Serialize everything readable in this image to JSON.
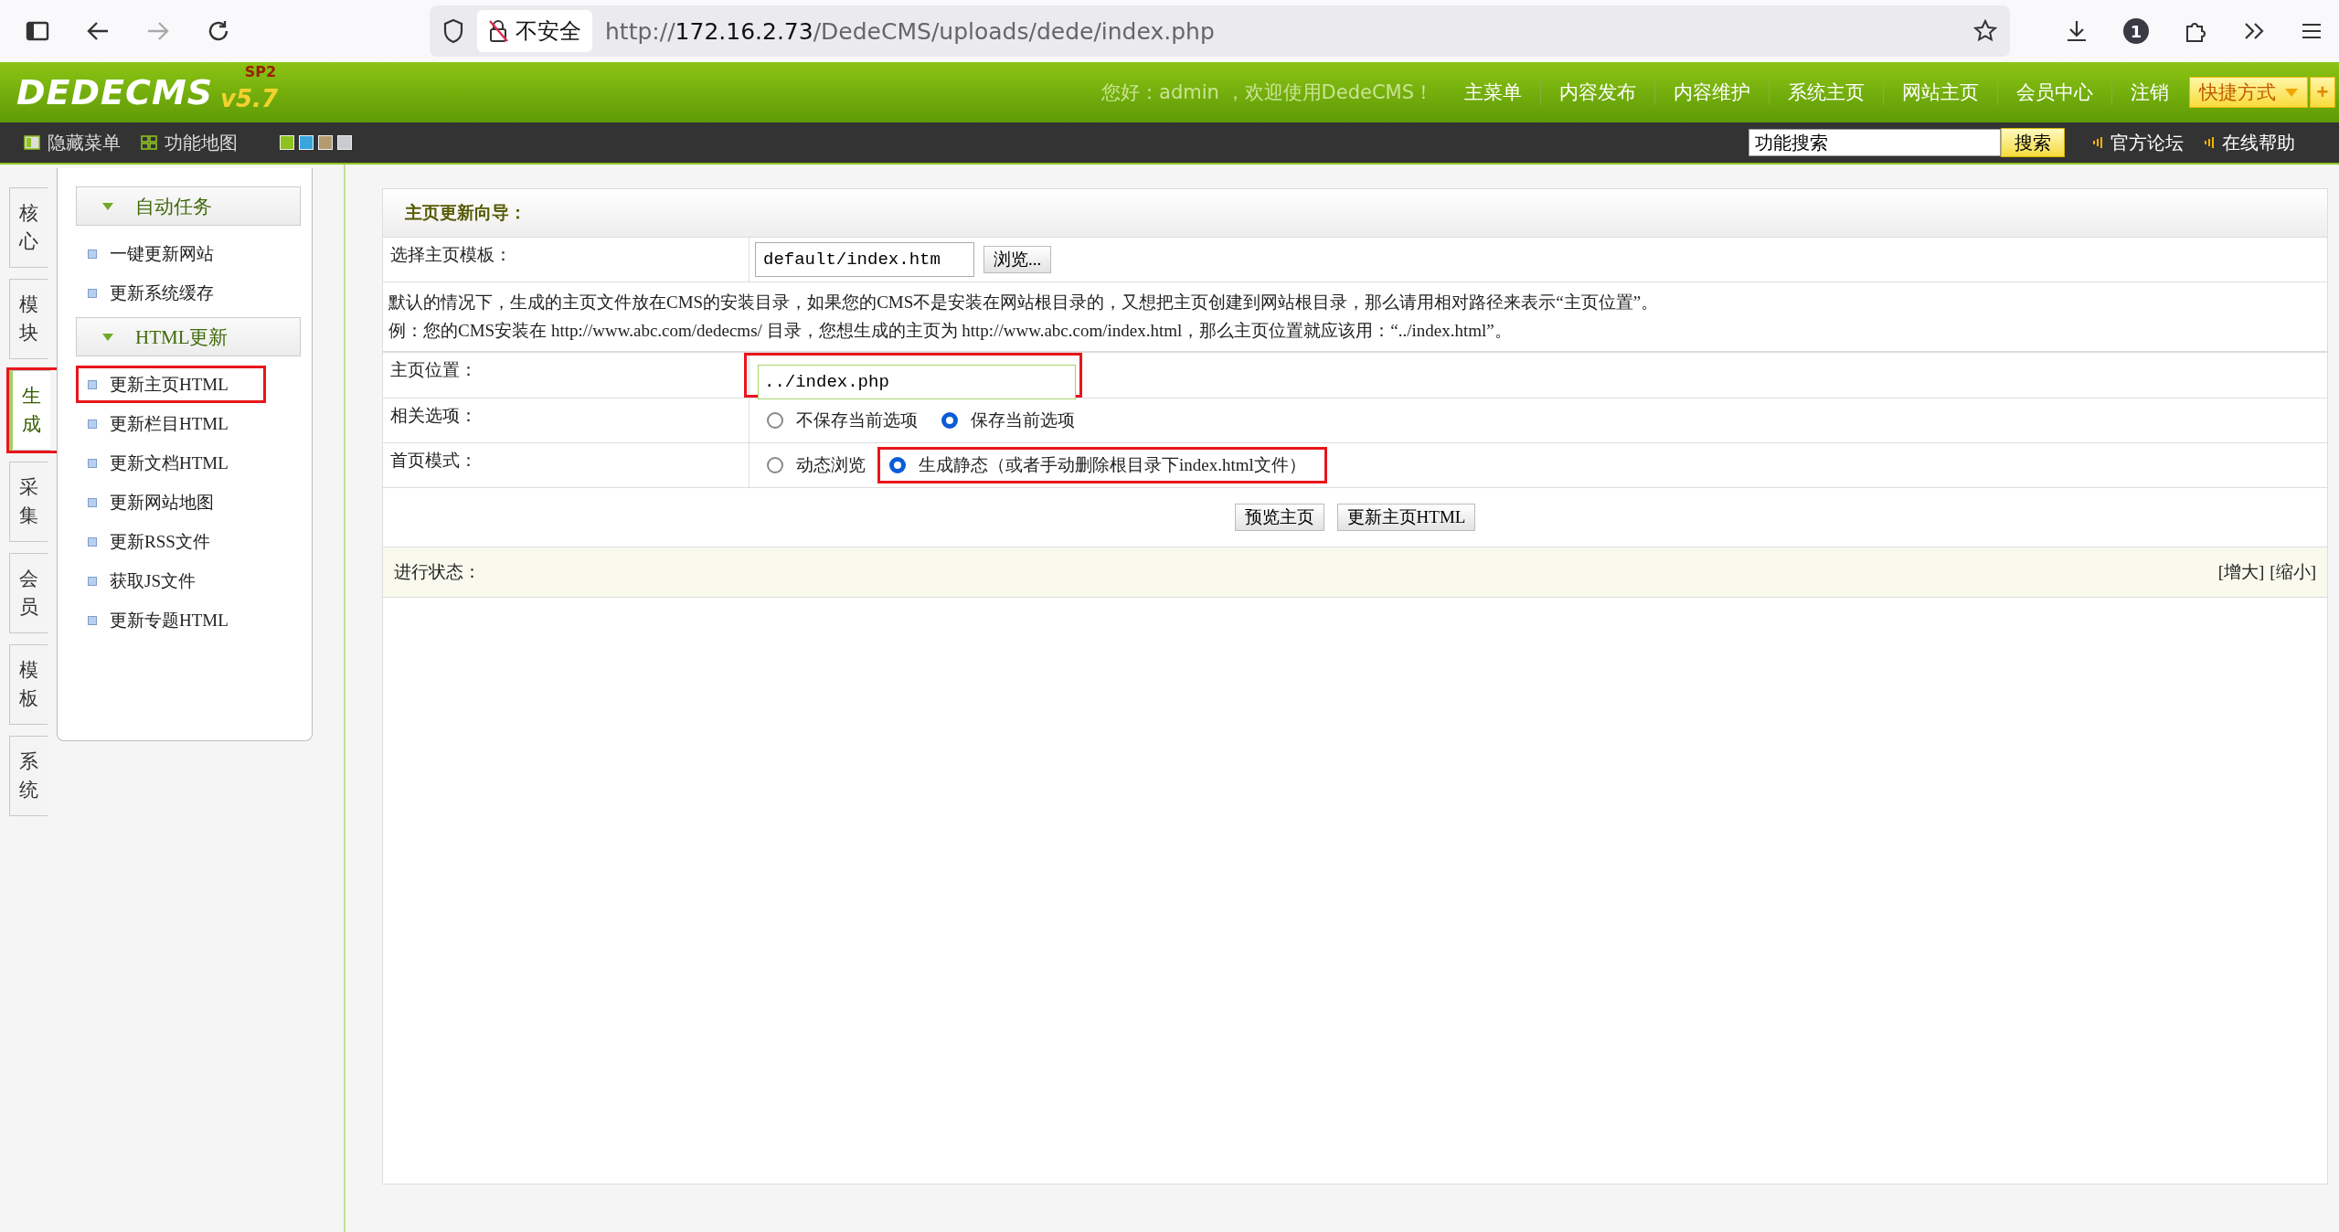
{
  "browser": {
    "security_label": "不安全",
    "url_host": "172.16.2.73",
    "url_prefix": "http://",
    "url_path": "/DedeCMS/uploads/dede/index.php",
    "badge": "1"
  },
  "header": {
    "logo": "DEDECMS",
    "version": "v5.7",
    "edition": "SP2",
    "greeting": "您好：admin ，欢迎使用DedeCMS！",
    "nav": [
      "主菜单",
      "内容发布",
      "内容维护",
      "系统主页",
      "网站主页",
      "会员中心",
      "注销"
    ],
    "shortcut": "快捷方式",
    "shortcut_add": "+"
  },
  "toolbar": {
    "items": [
      "隐藏菜单",
      "功能地图"
    ],
    "skins": [
      {
        "color": "#8ec21f"
      },
      {
        "color": "#3aa5dd"
      },
      {
        "color": "#b39b6f"
      },
      {
        "color": "#c8ccd0"
      }
    ],
    "search_value": "功能搜索",
    "search_button": "搜索",
    "links": [
      "官方论坛",
      "在线帮助"
    ]
  },
  "side_tabs": [
    {
      "label": "核心",
      "selected": false,
      "highlighted": false
    },
    {
      "label": "模块",
      "selected": false,
      "highlighted": false
    },
    {
      "label": "生成",
      "selected": true,
      "highlighted": true
    },
    {
      "label": "采集",
      "selected": false,
      "highlighted": false
    },
    {
      "label": "会员",
      "selected": false,
      "highlighted": false
    },
    {
      "label": "模板",
      "selected": false,
      "highlighted": false
    },
    {
      "label": "系统",
      "selected": false,
      "highlighted": false
    }
  ],
  "menu_groups": [
    {
      "title": "自动任务",
      "expanded": true,
      "items": [
        {
          "label": "一键更新网站",
          "highlighted": false
        },
        {
          "label": "更新系统缓存",
          "highlighted": false
        }
      ]
    },
    {
      "title": "HTML更新",
      "expanded": true,
      "items": [
        {
          "label": "更新主页HTML",
          "highlighted": true
        },
        {
          "label": "更新栏目HTML",
          "highlighted": false
        },
        {
          "label": "更新文档HTML",
          "highlighted": false
        },
        {
          "label": "更新网站地图",
          "highlighted": false
        },
        {
          "label": "更新RSS文件",
          "highlighted": false
        },
        {
          "label": "获取JS文件",
          "highlighted": false
        },
        {
          "label": "更新专题HTML",
          "highlighted": false
        }
      ]
    }
  ],
  "form": {
    "title": "主页更新向导：",
    "template": {
      "label": "选择主页模板：",
      "value": "default/index.htm",
      "browse_button": "浏览..."
    },
    "notes": [
      "默认的情况下，生成的主页文件放在CMS的安装目录，如果您的CMS不是安装在网站根目录的，又想把主页创建到网站根目录，那么请用相对路径来表示“主页位置”。",
      "例：您的CMS安装在 http://www.abc.com/dedecms/ 目录，您想生成的主页为 http://www.abc.com/index.html，那么主页位置就应该用：“../index.html”。"
    ],
    "location": {
      "label": "主页位置：",
      "value": "../index.php",
      "highlighted": true
    },
    "radio_rows": [
      {
        "label": "相关选项：",
        "options": [
          {
            "label": "不保存当前选项",
            "selected": false,
            "highlighted": false
          },
          {
            "label": "保存当前选项",
            "selected": true,
            "highlighted": false
          }
        ]
      },
      {
        "label": "首页模式：",
        "options": [
          {
            "label": "动态浏览",
            "selected": false,
            "highlighted": false
          },
          {
            "label": "生成静态（或者手动删除根目录下index.html文件）",
            "selected": true,
            "highlighted": true
          }
        ]
      }
    ],
    "buttons": [
      "预览主页",
      "更新主页HTML"
    ]
  },
  "status": {
    "label": "进行状态：",
    "actions": [
      "[增大]",
      "[缩小]"
    ]
  }
}
